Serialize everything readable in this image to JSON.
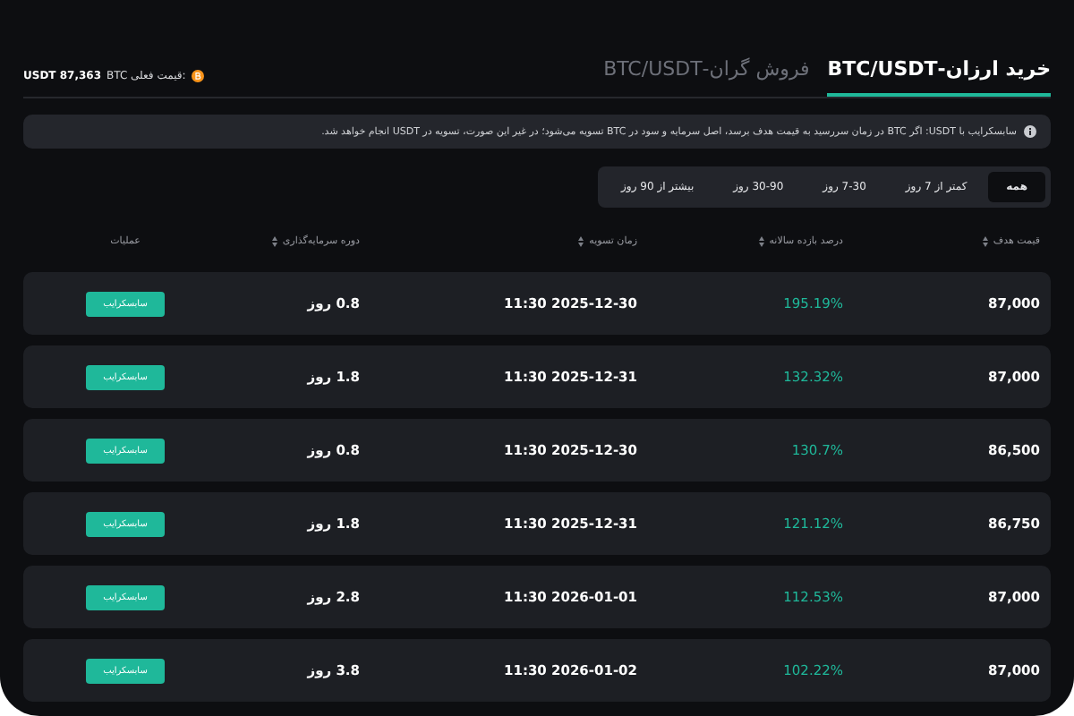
{
  "tabs": [
    {
      "label": "خرید ارزان-BTC/USDT",
      "selected": true
    },
    {
      "label": "فروش گران-BTC/USDT",
      "selected": false
    }
  ],
  "price": {
    "label": "BTC قیمت فعلی:",
    "value": "USDT 87,363"
  },
  "notice": "سابسکرایب با USDT: اگر BTC در زمان سررسید به قیمت هدف برسد، اصل سرمایه و سود در BTC تسویه می‌شود؛ در غیر این صورت، تسویه در USDT انجام خواهد شد.",
  "filters": [
    {
      "label": "همه",
      "selected": true
    },
    {
      "label": "کمتر از 7 روز",
      "selected": false
    },
    {
      "label": "7-30 روز",
      "selected": false
    },
    {
      "label": "30-90 روز",
      "selected": false
    },
    {
      "label": "بیشتر از 90 روز",
      "selected": false
    }
  ],
  "columns": [
    {
      "label": "قیمت هدف",
      "sortable": true
    },
    {
      "label": "درصد بازده سالانه",
      "sortable": true
    },
    {
      "label": "زمان تسویه",
      "sortable": true
    },
    {
      "label": "دوره سرمایه‌گذاری",
      "sortable": true
    },
    {
      "label": "عملیات",
      "sortable": false
    }
  ],
  "rows": [
    {
      "target": "87,000",
      "yield": "195.19%",
      "settle": "11:30 2025-12-30",
      "period": "0.8 روز",
      "action": "سابسکرایب"
    },
    {
      "target": "87,000",
      "yield": "132.32%",
      "settle": "11:30 2025-12-31",
      "period": "1.8 روز",
      "action": "سابسکرایب"
    },
    {
      "target": "86,500",
      "yield": "130.7%",
      "settle": "11:30 2025-12-30",
      "period": "0.8 روز",
      "action": "سابسکرایب"
    },
    {
      "target": "86,750",
      "yield": "121.12%",
      "settle": "11:30 2025-12-31",
      "period": "1.8 روز",
      "action": "سابسکرایب"
    },
    {
      "target": "87,000",
      "yield": "112.53%",
      "settle": "11:30 2026-01-01",
      "period": "2.8 روز",
      "action": "سابسکرایب"
    },
    {
      "target": "87,000",
      "yield": "102.22%",
      "settle": "11:30 2026-01-02",
      "period": "3.8 روز",
      "action": "سابسکرایب"
    }
  ]
}
